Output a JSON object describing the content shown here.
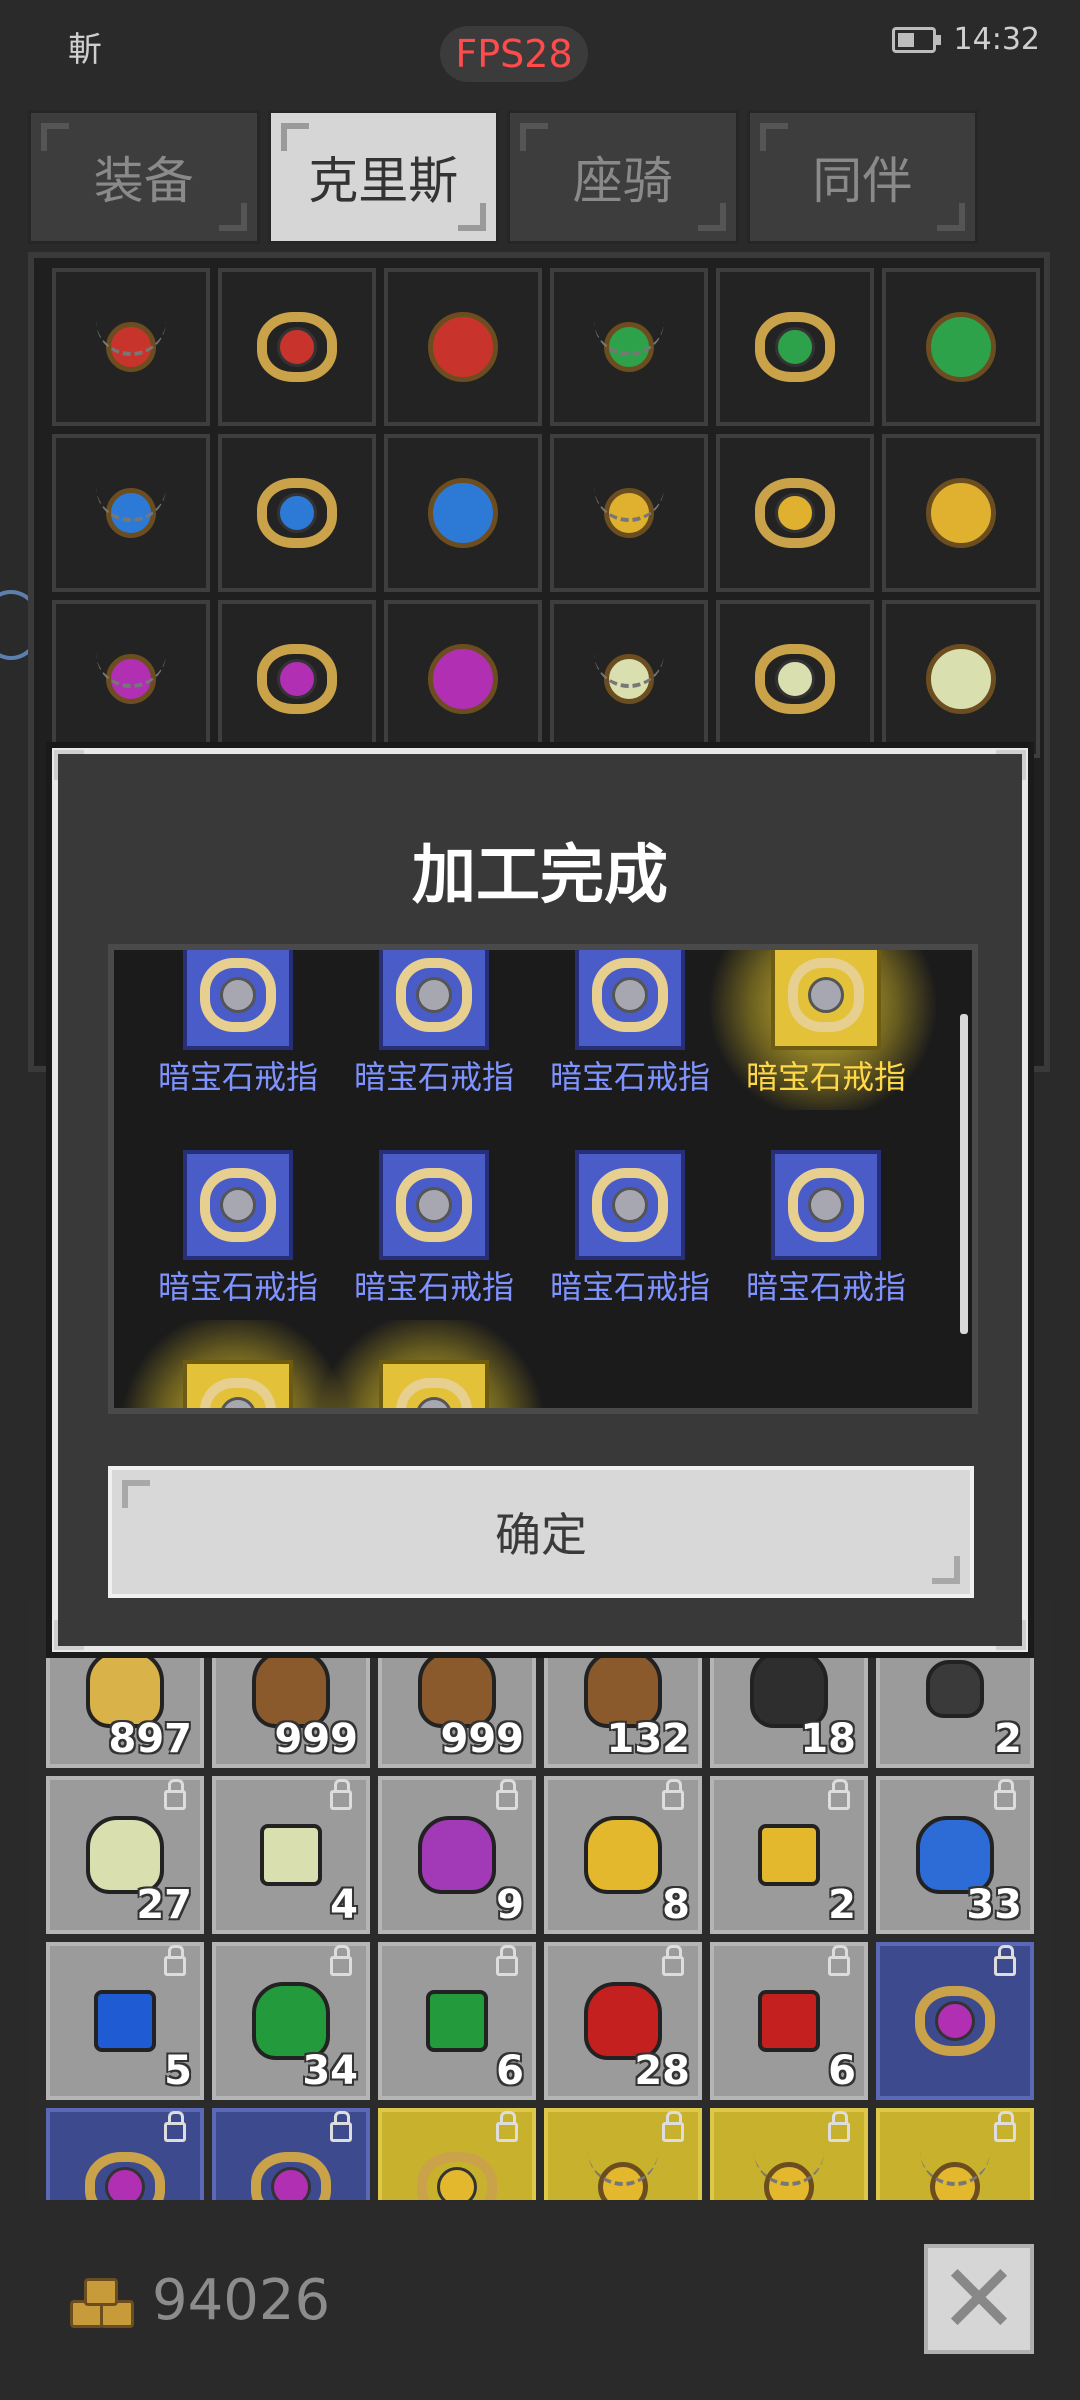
{
  "status_bar": {
    "left_text": "斬",
    "fps": "FPS28",
    "time": "14:32"
  },
  "tabs": [
    {
      "label": "装备",
      "active": false
    },
    {
      "label": "克里斯",
      "active": true
    },
    {
      "label": "座骑",
      "active": false
    },
    {
      "label": "同伴",
      "active": false
    }
  ],
  "modal": {
    "title": "加工完成",
    "results": [
      {
        "label": "暗宝石戒指",
        "highlight": false
      },
      {
        "label": "暗宝石戒指",
        "highlight": false
      },
      {
        "label": "暗宝石戒指",
        "highlight": false
      },
      {
        "label": "暗宝石戒指",
        "highlight": true
      },
      {
        "label": "暗宝石戒指",
        "highlight": false
      },
      {
        "label": "暗宝石戒指",
        "highlight": false
      },
      {
        "label": "暗宝石戒指",
        "highlight": false
      },
      {
        "label": "暗宝石戒指",
        "highlight": false
      }
    ],
    "confirm_label": "确定"
  },
  "inventory_counts": {
    "row1": [
      "897",
      "999",
      "999",
      "132",
      "18",
      "2"
    ],
    "row2": [
      "27",
      "4",
      "9",
      "8",
      "2",
      "33"
    ],
    "row3": [
      "5",
      "34",
      "6",
      "28",
      "6",
      ""
    ]
  },
  "footer": {
    "gold_amount": "94026"
  },
  "colors": {
    "accent_blue": "#4a5cc8",
    "label_blue": "#7f93ff",
    "label_gold": "#ffd84a",
    "fps_red": "#ff4b4b"
  },
  "icons": [
    "battery-icon",
    "gold-coins-icon",
    "close-icon",
    "lock-icon",
    "ring-icon",
    "necklace-icon",
    "amulet-icon",
    "gem-icon"
  ]
}
